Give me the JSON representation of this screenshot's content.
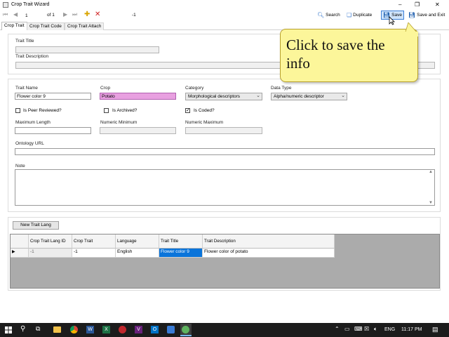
{
  "window": {
    "title": "Crop Trait Wizard",
    "controls": [
      "–",
      "❐",
      "✕"
    ]
  },
  "navigator": {
    "position": "1",
    "of_text": "of 1",
    "count_field": "-1"
  },
  "toolbar": {
    "search_label": "Search",
    "duplicate_label": "Duplicate",
    "save_label": "Save",
    "save_exit_label": "Save and Exit"
  },
  "tabs": [
    "Crop Trait",
    "Crop Trait Code",
    "Crop Trait Attach"
  ],
  "trait_title_group": {
    "title_label": "Trait Title",
    "title_value": "",
    "description_label": "Trait Description",
    "description_value": ""
  },
  "callout": {
    "text": "Click to save the info"
  },
  "form": {
    "trait_name_label": "Trait Name",
    "trait_name_value": "Flower color 9",
    "crop_label": "Crop",
    "crop_value": "Potato",
    "category_label": "Category",
    "category_value": "Morphological descriptors",
    "data_type_label": "Data Type",
    "data_type_value": "Alpha/numeric descriptor",
    "peer_reviewed_label": "Is Peer Reviewed?",
    "peer_reviewed_checked": false,
    "archived_label": "Is Archived?",
    "archived_checked": false,
    "coded_label": "Is Coded?",
    "coded_checked": true,
    "max_length_label": "Maximum Length",
    "max_length_value": "",
    "numeric_min_label": "Numeric Minimum",
    "numeric_min_value": "",
    "numeric_max_label": "Numeric Maximum",
    "numeric_max_value": "",
    "ontology_label": "Ontology URL",
    "ontology_value": "",
    "note_label": "Note",
    "note_value": ""
  },
  "lang_section": {
    "new_button_label": "New Trait Lang",
    "columns": [
      "Crop Trait Lang ID",
      "Crop Trait",
      "Language",
      "Trait Title",
      "Trait Description"
    ],
    "rows": [
      [
        "-1",
        "-1",
        "English",
        "Flower color 9",
        "Flower color of potato"
      ]
    ]
  },
  "taskbar": {
    "language": "ENG",
    "time": "11:17 PM"
  },
  "colors": {
    "highlight_pink": "#e8a0e0",
    "callout_yellow": "#fcf69a",
    "grid_bg": "#ababab",
    "selected_cell": "#0a74da",
    "taskbar": "#1c1c1c"
  }
}
